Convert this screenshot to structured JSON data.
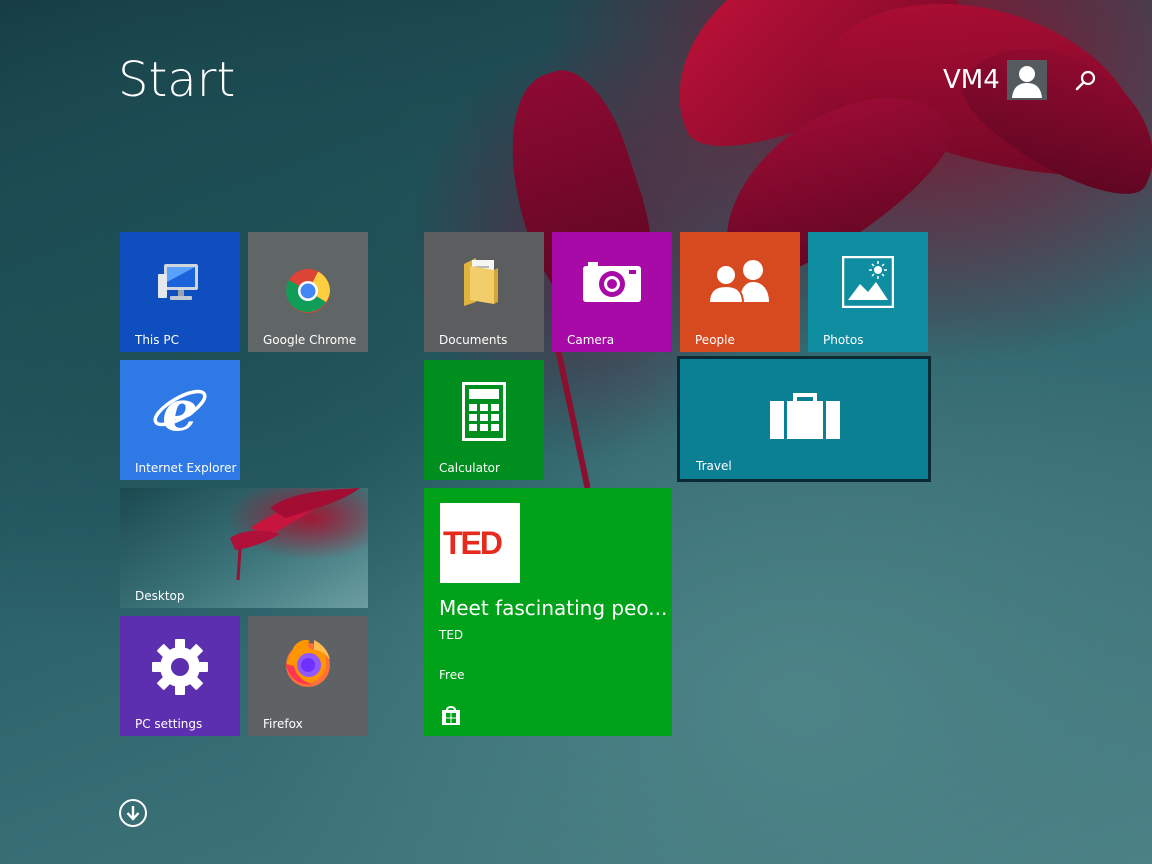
{
  "header": {
    "title": "Start",
    "user_name": "VM4"
  },
  "tiles": {
    "this_pc": {
      "label": "This PC",
      "color": "#0f4ebf"
    },
    "chrome": {
      "label": "Google Chrome",
      "color": "#606565"
    },
    "documents": {
      "label": "Documents",
      "color": "#5b5d5f"
    },
    "camera": {
      "label": "Camera",
      "color": "#a80aa8"
    },
    "people": {
      "label": "People",
      "color": "#d7491f"
    },
    "photos": {
      "label": "Photos",
      "color": "#0f8ea2"
    },
    "ie": {
      "label": "Internet Explorer",
      "color": "#2e79e6"
    },
    "calculator": {
      "label": "Calculator",
      "color": "#008f1e"
    },
    "travel": {
      "label": "Travel",
      "color": "#0b8094"
    },
    "desktop": {
      "label": "Desktop"
    },
    "ted": {
      "logo_text": "TED",
      "headline": "Meet fascinating peo...",
      "publisher": "TED",
      "price": "Free",
      "color": "#00a21a"
    },
    "pc_settings": {
      "label": "PC settings",
      "color": "#5c2fb0"
    },
    "firefox": {
      "label": "Firefox",
      "color": "#5f6264"
    }
  },
  "icons": {
    "search": "search-icon",
    "scroll_down": "arrow-down-circle-icon",
    "store": "store-icon"
  }
}
